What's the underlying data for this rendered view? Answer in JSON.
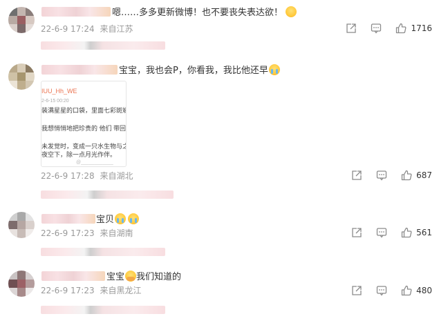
{
  "comments": [
    {
      "text": "嗯……多多更新微博！也不要丧失表达欲！",
      "emoji": "shy-face",
      "time": "22-6-9 17:24",
      "location": "来自江苏",
      "likes": "1716"
    },
    {
      "text": "宝宝，我也会P，你看我，我比他还早",
      "emoji": "crying-face",
      "time": "22-6-9 17:28",
      "location": "来自湖北",
      "likes": "687",
      "card": {
        "username": "IUU_Hh_WE",
        "date": "2-6-15 00:20",
        "lines": [
          "装满星星的口袋，里面七彩斑斓。",
          "我想悄悄地把珍贵的 他们 带回到",
          "未发觉时，变成一只水生物与之融",
          "夜空下，除一点月光作伴。"
        ],
        "footer": "@____________"
      }
    },
    {
      "text": "宝贝",
      "emoji": "crying-face",
      "time": "22-6-9 17:23",
      "location": "来自湖南",
      "likes": "561"
    },
    {
      "text": "宝宝",
      "text_after": "我们知道的",
      "emoji": "covering-mouth-face",
      "time": "22-6-9 17:23",
      "location": "来自黑龙江",
      "likes": "480"
    }
  ],
  "icons": {
    "share": "share-icon",
    "comment": "comment-icon",
    "like": "thumbs-up-icon"
  },
  "colors": {
    "meta_text": "#999999",
    "icon_stroke": "#8a8a8a",
    "card_username": "#eb7350"
  }
}
